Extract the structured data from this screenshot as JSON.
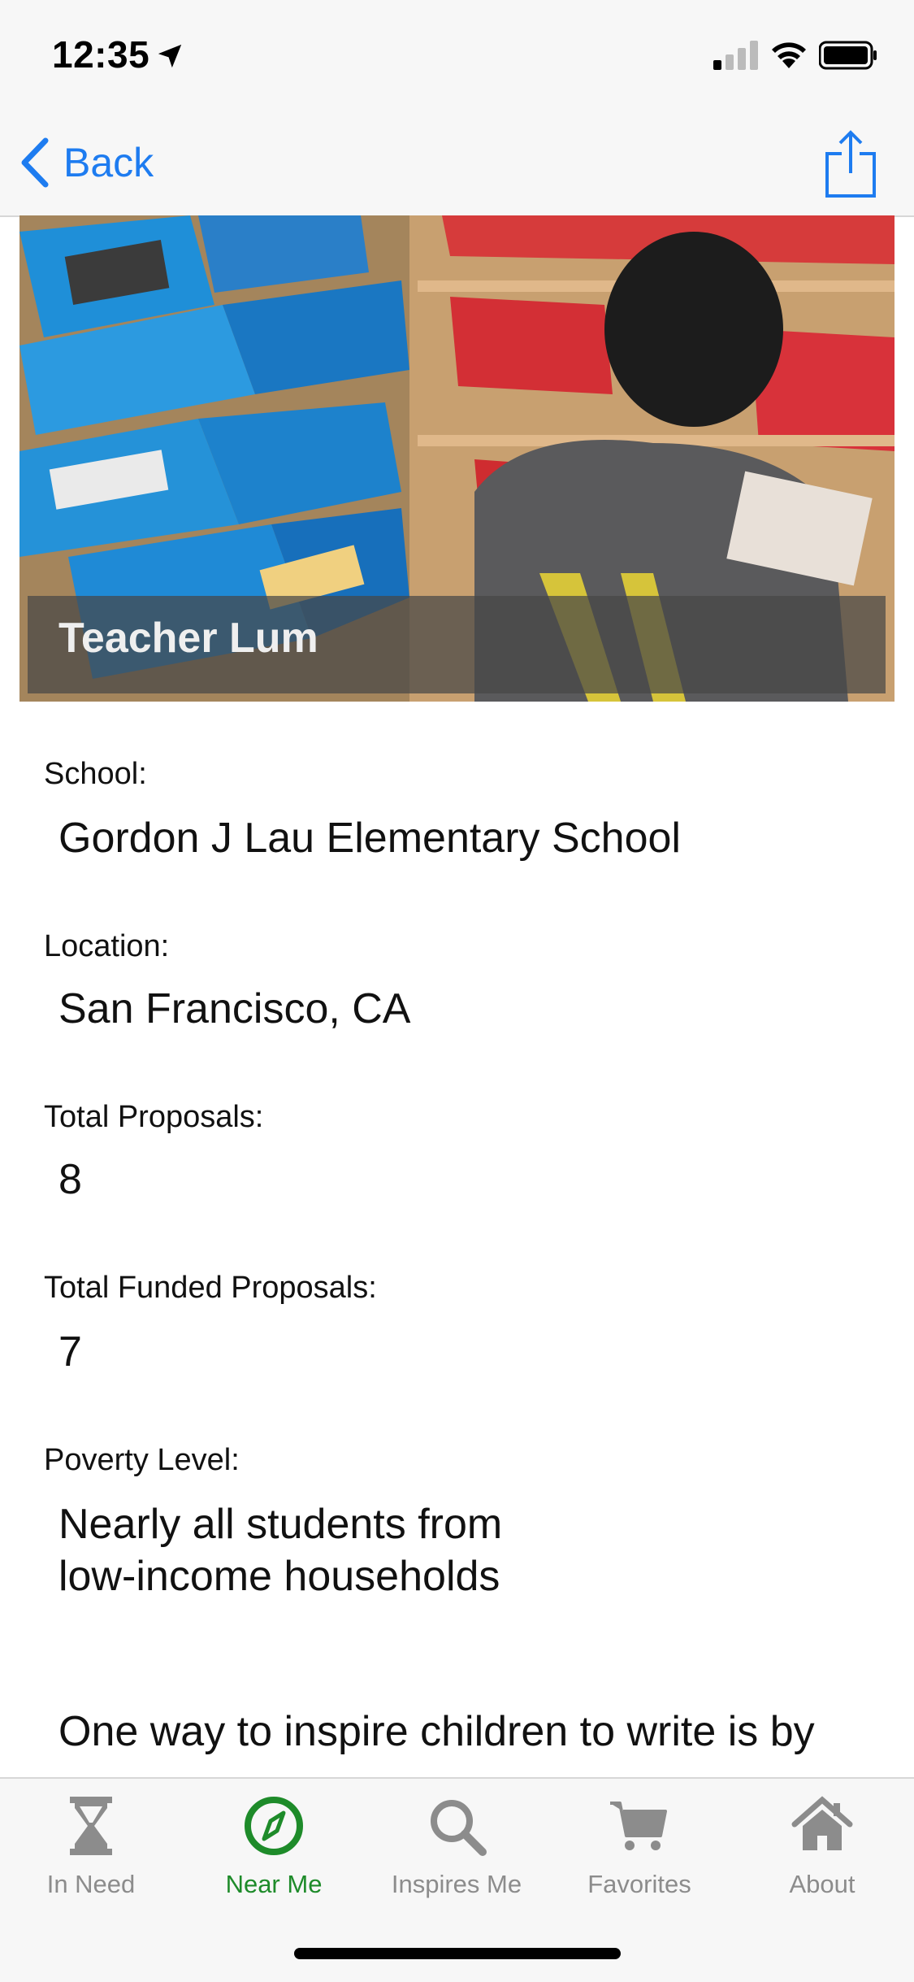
{
  "status_bar": {
    "time": "12:35"
  },
  "nav": {
    "back_label": "Back"
  },
  "hero": {
    "title": "Teacher Lum"
  },
  "fields": [
    {
      "label": "School:",
      "value": "Gordon J Lau Elementary School"
    },
    {
      "label": "Location:",
      "value": "San Francisco, CA"
    },
    {
      "label": "Total Proposals:",
      "value": "8"
    },
    {
      "label": "Total Funded Proposals:",
      "value": "7"
    },
    {
      "label": "Poverty Level:",
      "value_lines": [
        "Nearly all students from",
        "low-income households"
      ]
    }
  ],
  "description_partial": "One way to inspire children to write is by",
  "tabs": [
    {
      "label": "In Need",
      "icon": "hourglass-icon",
      "active": false
    },
    {
      "label": "Near Me",
      "icon": "compass-icon",
      "active": true
    },
    {
      "label": "Inspires Me",
      "icon": "search-icon",
      "active": false
    },
    {
      "label": "Favorites",
      "icon": "cart-icon",
      "active": false
    },
    {
      "label": "About",
      "icon": "home-icon",
      "active": false
    }
  ],
  "colors": {
    "accent": "#1e7cf0",
    "active_tab": "#1e8b2a",
    "inactive_tab": "#8c8c8c"
  }
}
